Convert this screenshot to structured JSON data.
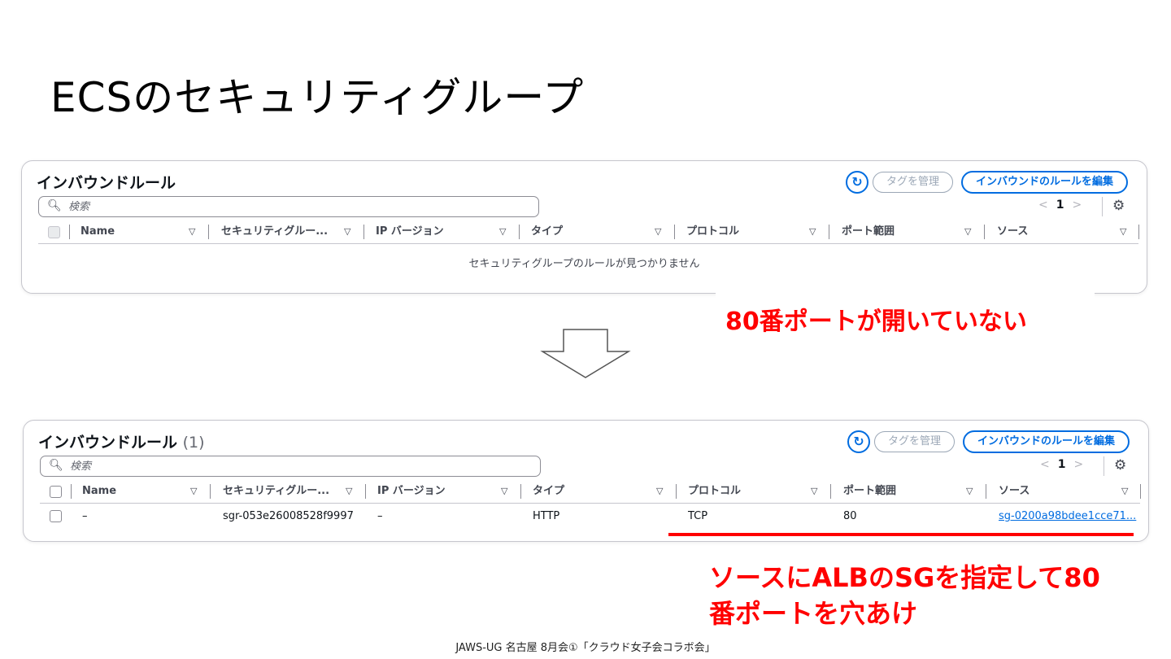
{
  "slide": {
    "title": "ECSのセキュリティグループ",
    "footer": "JAWS-UG 名古屋 8月会①「クラウド女子会コラボ会」"
  },
  "panel_before": {
    "heading": "インバウンドルール",
    "tag_button": "タグを管理",
    "edit_button": "インバウンドのルールを編集",
    "search_placeholder": "検索",
    "page_number": "1",
    "columns": [
      "Name",
      "セキュリティグルー...",
      "IP バージョン",
      "タイプ",
      "プロトコル",
      "ポート範囲",
      "ソース"
    ],
    "empty_message": "セキュリティグループのルールが見つかりません"
  },
  "annotation_before": "80番ポートが開いていない",
  "panel_after": {
    "heading": "インバウンドルール",
    "count": "(1)",
    "tag_button": "タグを管理",
    "edit_button": "インバウンドのルールを編集",
    "search_placeholder": "検索",
    "page_number": "1",
    "columns": [
      "Name",
      "セキュリティグルー...",
      "IP バージョン",
      "タイプ",
      "プロトコル",
      "ポート範囲",
      "ソース"
    ],
    "rows": [
      {
        "name": "–",
        "security_group_rule": "sgr-053e26008528f9997",
        "ip_version": "–",
        "type": "HTTP",
        "protocol": "TCP",
        "port_range": "80",
        "source": "sg-0200a98bdee1cce71..."
      }
    ]
  },
  "annotation_after_line1": "ソースにALBのSGを指定して80",
  "annotation_after_line2": "番ポートを穴あけ",
  "colors": {
    "accent": "#006ce0",
    "annotation": "#ff0000",
    "border": "#c6c6cd"
  },
  "icons": {
    "refresh": "refresh-icon",
    "search": "search-icon",
    "settings": "gear-icon",
    "sort": "sort-down-icon",
    "arrow": "down-arrow-icon"
  }
}
